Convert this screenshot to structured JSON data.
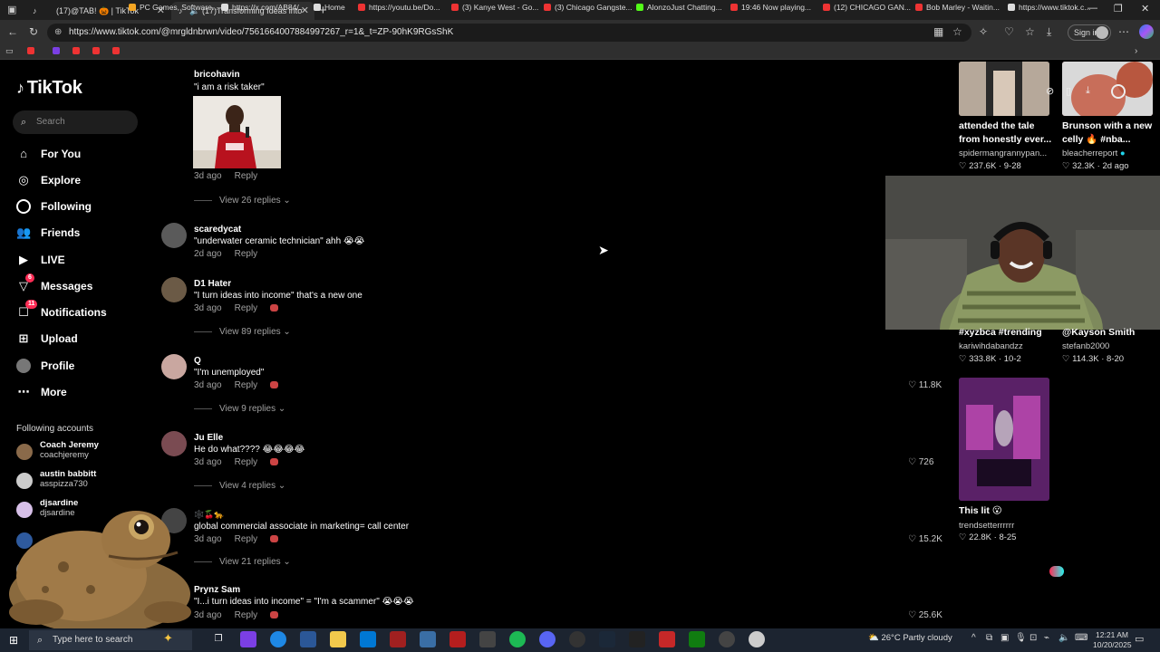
{
  "browser": {
    "tabs": [
      {
        "title": "(17)@TAB! 🎃 | TikTok",
        "active": false
      },
      {
        "title": "(17)Transforming Ideas into",
        "active": true
      }
    ],
    "url": "https://www.tiktok.com/@mrgldnbrwn/video/7561664007884997267_r=1&_t=ZP-90hK9RGsShK",
    "signin_label": "Sign in",
    "bookmarks": [
      "PC Games, Software...",
      "https://x.com/AB84/...",
      "Home",
      "https://youtu.be/Do...",
      "(3) Kanye West - Go...",
      "(3) Chicago Gangste...",
      "AlonzoJust Chatting...",
      "19:46 Now playing...",
      "(12) CHICAGO GAN...",
      "Bob Marley - Waitin...",
      "https://www.tiktok.c..."
    ]
  },
  "sidebar": {
    "logo": "TikTok",
    "search_placeholder": "Search",
    "nav": [
      {
        "label": "For You",
        "icon": "home-icon"
      },
      {
        "label": "Explore",
        "icon": "compass-icon"
      },
      {
        "label": "Following",
        "icon": "following-icon"
      },
      {
        "label": "Friends",
        "icon": "friends-icon"
      },
      {
        "label": "LIVE",
        "icon": "live-icon"
      },
      {
        "label": "Messages",
        "icon": "messages-icon",
        "badge": "6"
      },
      {
        "label": "Notifications",
        "icon": "notifications-icon",
        "badge": "11"
      },
      {
        "label": "Upload",
        "icon": "upload-icon"
      },
      {
        "label": "Profile",
        "icon": "profile-icon"
      },
      {
        "label": "More",
        "icon": "more-icon"
      }
    ],
    "following_title": "Following accounts",
    "accounts": [
      {
        "name": "Coach Jeremy",
        "handle": "coachjeremy"
      },
      {
        "name": "austin babbitt",
        "handle": "asspizza730"
      },
      {
        "name": "djsardine",
        "handle": "djsardine"
      }
    ]
  },
  "comments": [
    {
      "user": "bricohavin",
      "text": "\"i am a risk taker\"",
      "date": "3d ago",
      "reply": "Reply",
      "replies": "View 26 replies",
      "likes": ""
    },
    {
      "user": "scaredycat",
      "text": "\"underwater ceramic technician\" ahh 😭😭",
      "date": "2d ago",
      "reply": "Reply",
      "replies": "",
      "likes": ""
    },
    {
      "user": "D1 Hater",
      "text": "\"I turn ideas into income\" that's a new one",
      "date": "3d ago",
      "reply": "Reply",
      "replies": "View 89 replies",
      "likes": ""
    },
    {
      "user": "Q",
      "text": "\"I'm unemployed\"",
      "date": "3d ago",
      "reply": "Reply",
      "replies": "View 9 replies",
      "likes": "11.8K"
    },
    {
      "user": "Ju Elle",
      "text": "He do what???? 😂😂😂😂",
      "date": "3d ago",
      "reply": "Reply",
      "replies": "View 4 replies",
      "likes": "726"
    },
    {
      "user": "🕸️🍒🐆",
      "text": "global commercial associate in marketing= call center",
      "date": "3d ago",
      "reply": "Reply",
      "replies": "View 21 replies",
      "likes": "15.2K"
    },
    {
      "user": "Prynz Sam",
      "text": "\"I...i turn ideas into income\" = \"I'm a scammer\" 😭😭😭",
      "date": "3d ago",
      "reply": "Reply",
      "replies": "",
      "likes": "25.6K"
    }
  ],
  "related": [
    {
      "caption1": "attended the tale",
      "caption2": "from honestly ever...",
      "author": "spidermangrannypan...",
      "likes": "237.6K",
      "date": "9-28"
    },
    {
      "caption1": "Brunson with a new",
      "caption2": "celly 🔥 #nba...",
      "author": "bleacherreport",
      "likes": "32.3K",
      "date": "2d ago"
    },
    {
      "caption1": "#xyzbca #trending",
      "caption2": "",
      "author": "kariwihdabandzz",
      "likes": "333.8K",
      "date": "10-2"
    },
    {
      "caption1": "@Kayson Smith",
      "caption2": "",
      "author": "stefanb2000",
      "likes": "114.3K",
      "date": "8-20"
    },
    {
      "caption1": "This lit 😮",
      "caption2": "",
      "author": "trendsetterrrrrr",
      "likes": "22.8K",
      "date": "8-25"
    }
  ],
  "taskbar": {
    "search_placeholder": "Type here to search",
    "weather": "26°C  Partly cloudy",
    "time": "12:21 AM",
    "date": "10/20/2025"
  }
}
